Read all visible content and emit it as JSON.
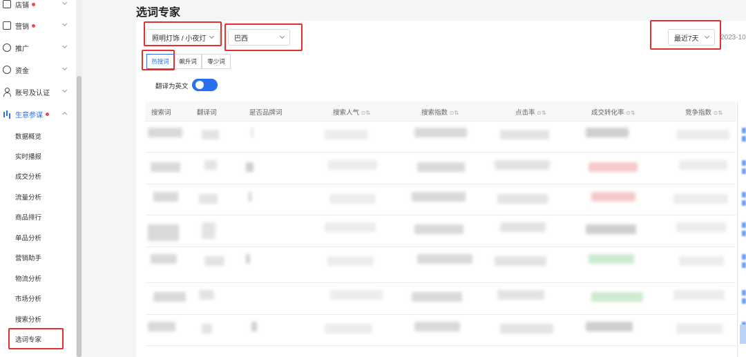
{
  "sidebar": {
    "items": [
      {
        "label": "店铺",
        "icon": "store-icon"
      },
      {
        "label": "营销",
        "icon": "marketing-icon"
      },
      {
        "label": "推广",
        "icon": "globe-icon"
      },
      {
        "label": "资金",
        "icon": "money-icon"
      },
      {
        "label": "账号及认证",
        "icon": "user-icon"
      },
      {
        "label": "生意参谋",
        "icon": "chart-icon"
      }
    ],
    "subitems": [
      "数据概览",
      "实时播报",
      "成交分析",
      "流量分析",
      "商品排行",
      "单品分析",
      "营销助手",
      "物流分析",
      "市场分析",
      "搜索分析",
      "选词专家"
    ],
    "active_subitem": "选词专家"
  },
  "page": {
    "title": "选词专家"
  },
  "filters": {
    "category": "照明灯饰 / 小夜灯",
    "country": "巴西",
    "period": "最近7天",
    "date_text": "2023-10"
  },
  "tabs": [
    "热搜词",
    "飙升词",
    "零少词"
  ],
  "active_tab": "热搜词",
  "toggle": {
    "label": "翻译为英文",
    "on": true
  },
  "table": {
    "columns": [
      "搜索词",
      "翻译词",
      "是否品牌词",
      "搜索人气",
      "搜索指数",
      "点击率",
      "成交转化率",
      "竞争指数"
    ]
  },
  "colors": {
    "accent": "#2a6ff0",
    "highlight_box": "#e3302f",
    "alert_dot": "#f04848"
  }
}
